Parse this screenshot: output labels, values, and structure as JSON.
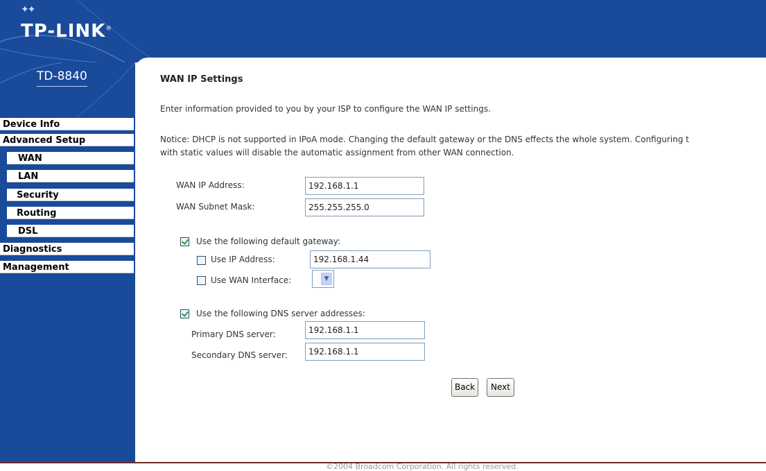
{
  "brand": {
    "logo": "TP-LINK",
    "model": "TD-8840"
  },
  "menu": [
    {
      "label": "Device Info"
    },
    {
      "label": "Advanced Setup"
    },
    {
      "label": "WAN"
    },
    {
      "label": "LAN"
    },
    {
      "label": "Security"
    },
    {
      "label": "Routing"
    },
    {
      "label": "DSL"
    },
    {
      "label": "Diagnostics"
    },
    {
      "label": "Management"
    }
  ],
  "page": {
    "title": "WAN IP Settings",
    "intro": "Enter information provided to you by your ISP to configure the WAN IP settings.",
    "notice_line1": "Notice: DHCP is not supported in IPoA mode. Changing the default gateway or the DNS effects the whole system. Configuring t",
    "notice_line2": "with static values will disable the automatic assignment from other WAN connection."
  },
  "wan": {
    "ip_label": "WAN IP Address:",
    "ip_value": "192.168.1.1",
    "mask_label": "WAN Subnet Mask:",
    "mask_value": "255.255.255.0"
  },
  "gateway": {
    "checked": true,
    "label": "Use the following default gateway:",
    "use_ip_label": "Use IP Address:",
    "use_ip_checked": false,
    "ip_value": "192.168.1.44",
    "use_wan_label": "Use WAN Interface:",
    "use_wan_checked": false
  },
  "dns": {
    "checked": true,
    "label": "Use the following DNS server addresses:",
    "primary_label": "Primary DNS server:",
    "primary_value": "192.168.1.1",
    "secondary_label": "Secondary DNS server:",
    "secondary_value": "192.168.1.1"
  },
  "buttons": {
    "back": "Back",
    "next": "Next"
  },
  "footer": "©2004 Broadcom Corporation. All rights reserved.",
  "colors": {
    "header_bg": "#1a4a9a",
    "checkmark": "#21a121"
  }
}
